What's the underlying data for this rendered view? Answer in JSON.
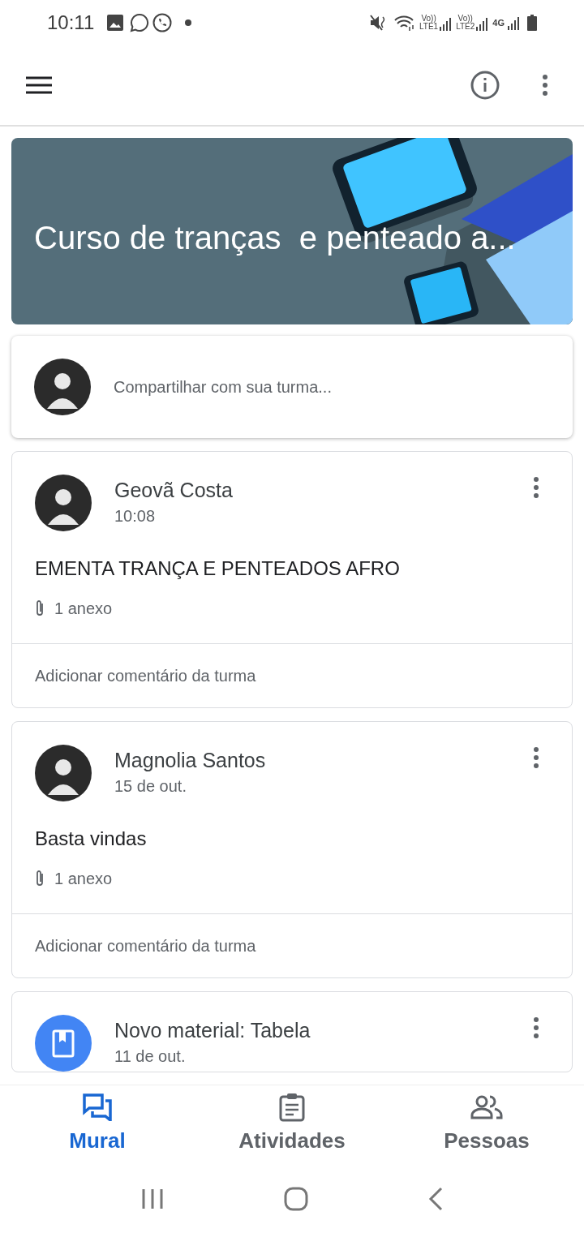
{
  "status_bar": {
    "time": "10:11",
    "sim1": {
      "volte": "Vo))",
      "network": "LTE1"
    },
    "sim2": {
      "volte": "Vo))",
      "network": "LTE2"
    },
    "data_type": "4G"
  },
  "banner": {
    "title": "Curso de tranças  e penteado a..."
  },
  "share": {
    "placeholder": "Compartilhar com sua turma..."
  },
  "posts": [
    {
      "kind": "announcement",
      "author": "Geovã Costa",
      "time": "10:08",
      "text": "EMENTA TRANÇA E PENTEADOS AFRO",
      "attachments": "1 anexo",
      "comment_placeholder": "Adicionar comentário da turma"
    },
    {
      "kind": "announcement",
      "author": "Magnolia Santos",
      "time": "15 de out.",
      "text": "Basta vindas",
      "attachments": "1 anexo",
      "comment_placeholder": "Adicionar comentário da turma"
    },
    {
      "kind": "material",
      "author": "Novo material: Tabela",
      "time": "11 de out."
    }
  ],
  "bottom_nav": [
    {
      "label": "Mural",
      "kind": "stream",
      "selected": true
    },
    {
      "label": "Atividades",
      "kind": "classwork",
      "selected": false
    },
    {
      "label": "Pessoas",
      "kind": "people",
      "selected": false
    }
  ]
}
